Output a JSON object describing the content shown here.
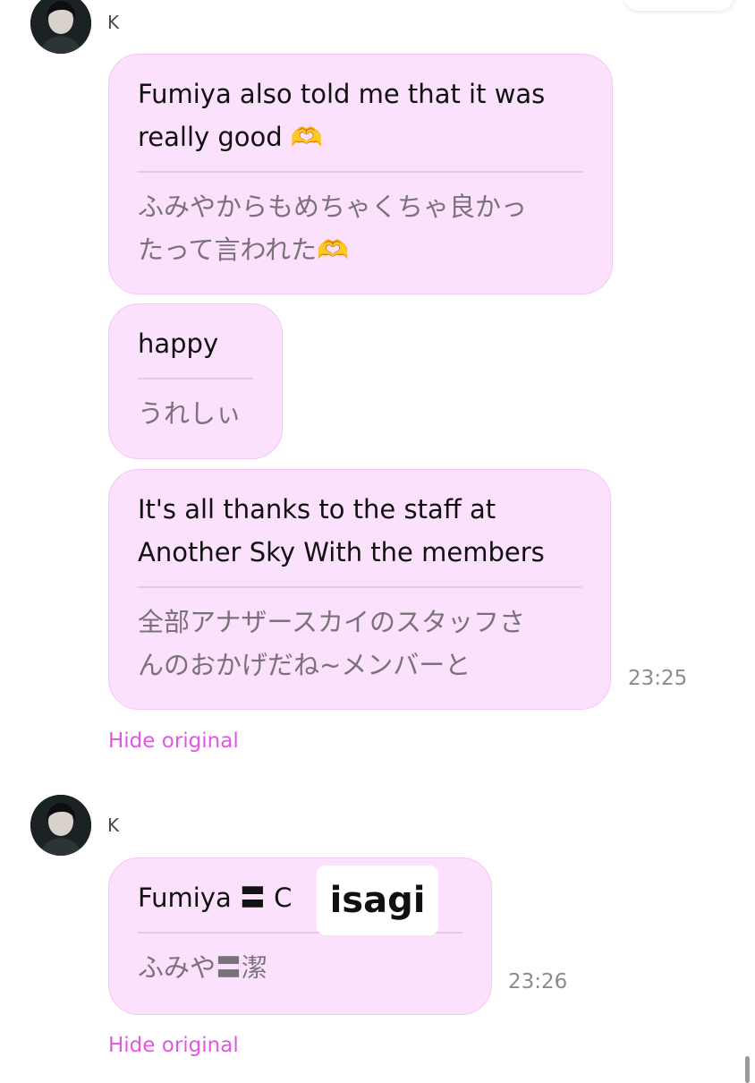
{
  "messages": [
    {
      "sender": "K",
      "bubbles": [
        {
          "translation": "Fumiya also told me that it was\nreally good 🫶",
          "original": "ふみやからもめちゃくちゃ良かっ\nたって言われた🫶"
        },
        {
          "translation": "happy",
          "original": "うれしぃ"
        },
        {
          "translation": "It's all thanks to the staff at\nAnother Sky With the members",
          "original": "全部アナザースカイのスタッフさ\nんのおかげだね~メンバーと"
        }
      ],
      "time": "23:25",
      "hide_label": "Hide original"
    },
    {
      "sender": "K",
      "bubbles": [
        {
          "translation": "Fumiya 〓 C           ss",
          "original": "ふみや〓潔"
        }
      ],
      "time": "23:26",
      "hide_label": "Hide original",
      "sticker_text": "isagi"
    }
  ],
  "colors": {
    "bubble_bg": "#fbe1fb",
    "bubble_border": "#f3c7f3",
    "link": "#e455e4"
  }
}
